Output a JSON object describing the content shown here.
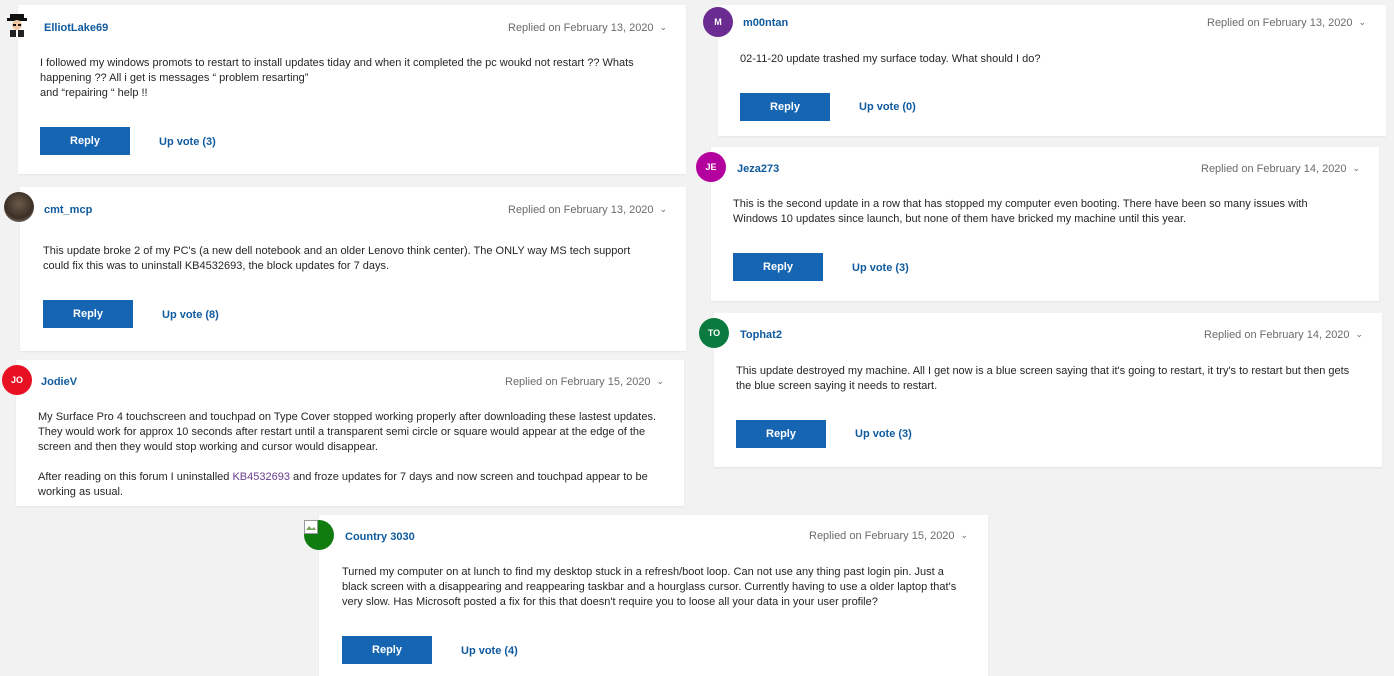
{
  "posts": [
    {
      "user": "ElliotLake69",
      "replied": "Replied on February 13, 2020",
      "body": [
        "I followed my windows promots to restart to install updates tiday and when it completed the pc woukd not restart ?? Whats happening ?? All i get is messages “ problem resarting”",
        "and “repairing “ help !!"
      ],
      "reply": "Reply",
      "upvote": "Up vote (3)"
    },
    {
      "user": "cmt_mcp",
      "replied": "Replied on February 13, 2020",
      "body": [
        "This update broke 2 of my PC's (a new dell notebook and an older Lenovo think center).  The ONLY way MS tech support could fix this was to uninstall KB4532693, the block updates for 7 days."
      ],
      "reply": "Reply",
      "upvote": "Up vote (8)"
    },
    {
      "user": "JodieV",
      "avatar_initials": "JO",
      "replied": "Replied on February 15, 2020",
      "body": [
        "My Surface Pro 4 touchscreen and touchpad on Type Cover stopped working properly after downloading these lastest updates.  They would work for approx 10 seconds after restart until a transparent semi circle or square would appear at the edge of the screen and then they would stop working and cursor would disappear."
      ],
      "body2_pre": "After reading on this forum I uninstalled ",
      "body2_link": "KB4532693",
      "body2_post": "  and froze updates for 7 days and now screen and touchpad appear to be working as usual."
    },
    {
      "user": "Country 3030",
      "replied": "Replied on February 15, 2020",
      "body": [
        "Turned my computer on at lunch to find my desktop stuck in a refresh/boot loop. Can not use any thing past login pin. Just a black screen with a disappearing and reappearing taskbar and a hourglass cursor. Currently having to use a older laptop that's very slow. Has Microsoft posted a fix for this that doesn't require you to loose all your data in your user profile?"
      ],
      "reply": "Reply",
      "upvote": "Up vote (4)"
    },
    {
      "user": "m00ntan",
      "avatar_initials": "M",
      "replied": "Replied on February 13, 2020",
      "body": [
        "02-11-20 update trashed my surface today. What should I do?"
      ],
      "reply": "Reply",
      "upvote": "Up vote (0)"
    },
    {
      "user": "Jeza273",
      "avatar_initials": "JE",
      "replied": "Replied on February 14, 2020",
      "body": [
        "This is the second update in a row that has stopped my computer even booting. There have been so many issues with Windows 10 updates since launch, but none of them have bricked my machine until this year."
      ],
      "reply": "Reply",
      "upvote": "Up vote (3)"
    },
    {
      "user": "Tophat2",
      "avatar_initials": "TO",
      "replied": "Replied on February 14, 2020",
      "body": [
        "This update destroyed my machine.  All I get now is a blue screen saying that it's going to restart, it try's to restart but then gets the blue screen saying it needs to restart."
      ],
      "reply": "Reply",
      "upvote": "Up vote (3)"
    }
  ],
  "colors": {
    "m00ntan": "#6b2c91",
    "Jeza273": "#b4009e",
    "Tophat2": "#0b7a3e",
    "JodieV": "#e81123",
    "Country 3030": "#107c10",
    "button": "#1565b3",
    "link": "#0f5a9e"
  }
}
